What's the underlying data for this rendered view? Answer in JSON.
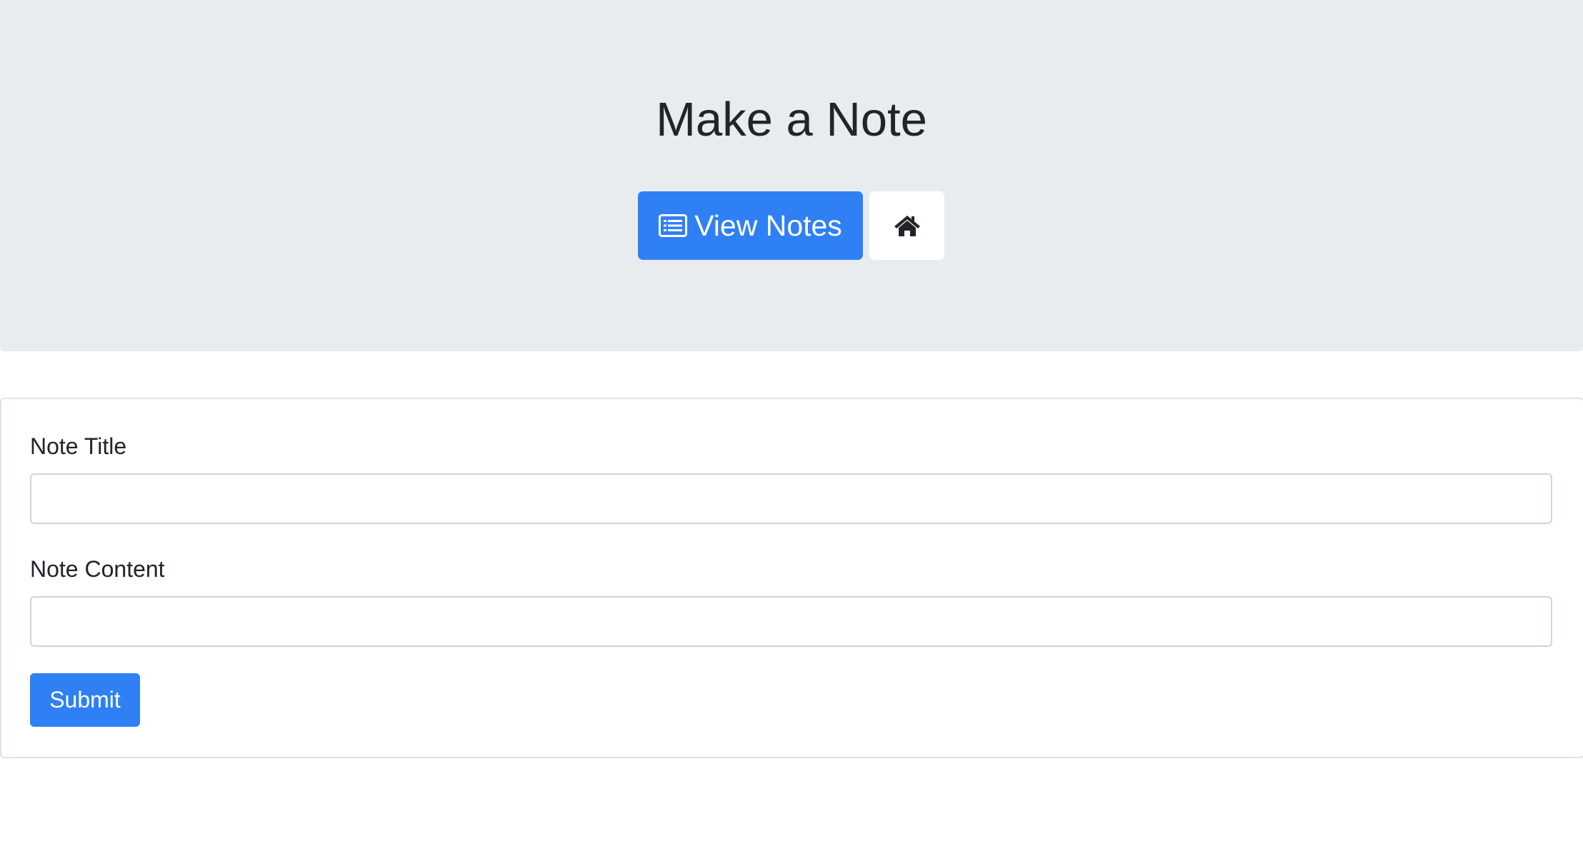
{
  "header": {
    "title": "Make a Note",
    "view_notes_label": "View Notes",
    "view_notes_icon": "list-alt-icon",
    "home_icon": "home-icon"
  },
  "form": {
    "title_label": "Note Title",
    "title_value": "",
    "title_placeholder": "",
    "content_label": "Note Content",
    "content_value": "",
    "content_placeholder": "",
    "submit_label": "Submit"
  },
  "colors": {
    "primary": "#2f80f5",
    "jumbotron_bg": "#e9ecef",
    "text": "#212529"
  }
}
